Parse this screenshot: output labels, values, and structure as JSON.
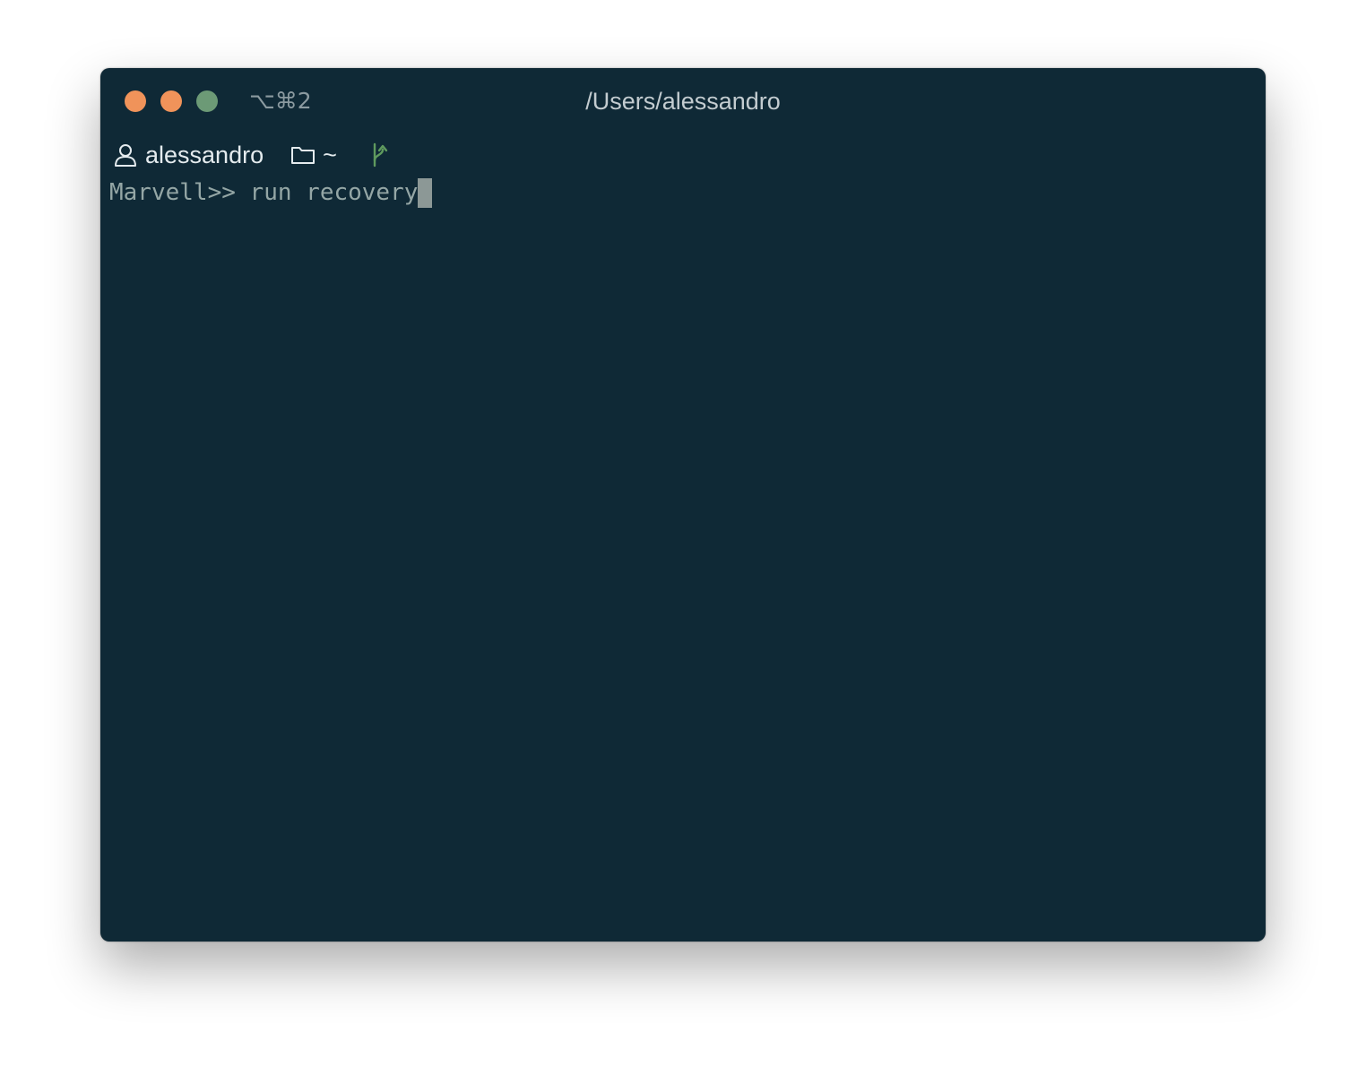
{
  "window": {
    "title": "/Users/alessandro",
    "shortcut": "⌥⌘2",
    "traffic_lights": {
      "close_color": "#f0935a",
      "minimize_color": "#f0935a",
      "zoom_color": "#6c9a76"
    }
  },
  "statusline": {
    "user": {
      "icon": "user-icon",
      "label": "alessandro"
    },
    "directory": {
      "icon": "folder-icon",
      "label": "~"
    },
    "git": {
      "icon": "git-branch-icon",
      "color": "#5f9a5e"
    }
  },
  "terminal": {
    "prompt": "Marvell>> ",
    "command": "run recovery"
  },
  "colors": {
    "background": "#0f2936",
    "prompt_text": "#94a6a5",
    "cursor": "#8c9896"
  }
}
